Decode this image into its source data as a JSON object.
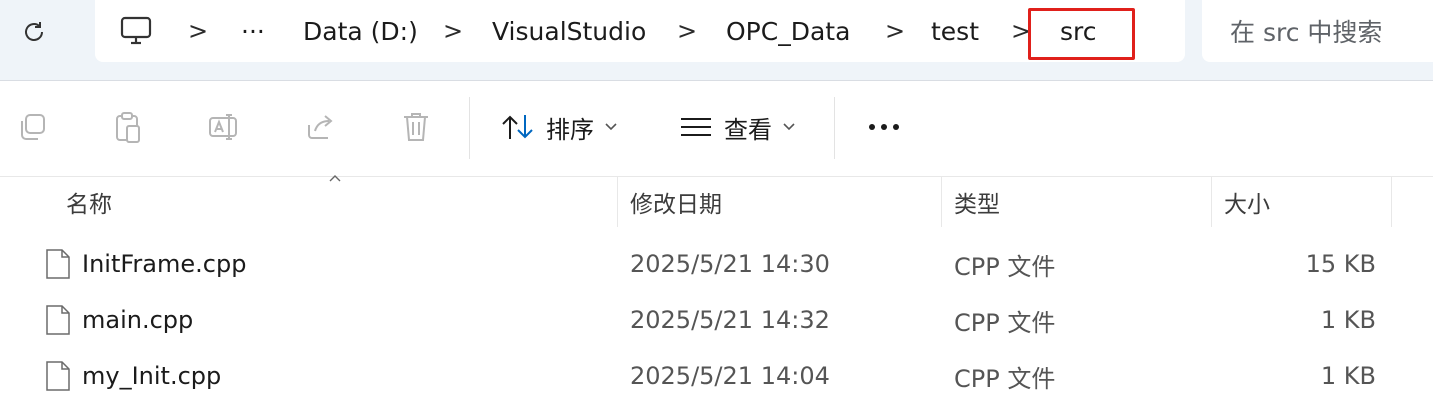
{
  "address_bar": {
    "breadcrumbs": [
      "Data (D:)",
      "VisualStudio",
      "OPC_Data",
      "test",
      "src"
    ],
    "overflow_label": "···",
    "separator": ">",
    "search_placeholder": "在 src 中搜索"
  },
  "toolbar": {
    "sort_label": "排序",
    "view_label": "查看",
    "more_label": "•••"
  },
  "columns": {
    "name": "名称",
    "date": "修改日期",
    "type": "类型",
    "size": "大小"
  },
  "files": [
    {
      "name": "InitFrame.cpp",
      "date": "2025/5/21 14:30",
      "type": "CPP 文件",
      "size": "15 KB"
    },
    {
      "name": "main.cpp",
      "date": "2025/5/21 14:32",
      "type": "CPP 文件",
      "size": "1 KB"
    },
    {
      "name": "my_Init.cpp",
      "date": "2025/5/21 14:04",
      "type": "CPP 文件",
      "size": "1 KB"
    }
  ],
  "colors": {
    "highlight_box": "#e0201b",
    "accent_blue": "#0067c0"
  },
  "icons": [
    "refresh-icon",
    "computer-icon",
    "copy-icon",
    "paste-icon",
    "rename-icon",
    "share-icon",
    "delete-icon",
    "sort-icon",
    "view-icon",
    "more-icon",
    "file-icon"
  ]
}
